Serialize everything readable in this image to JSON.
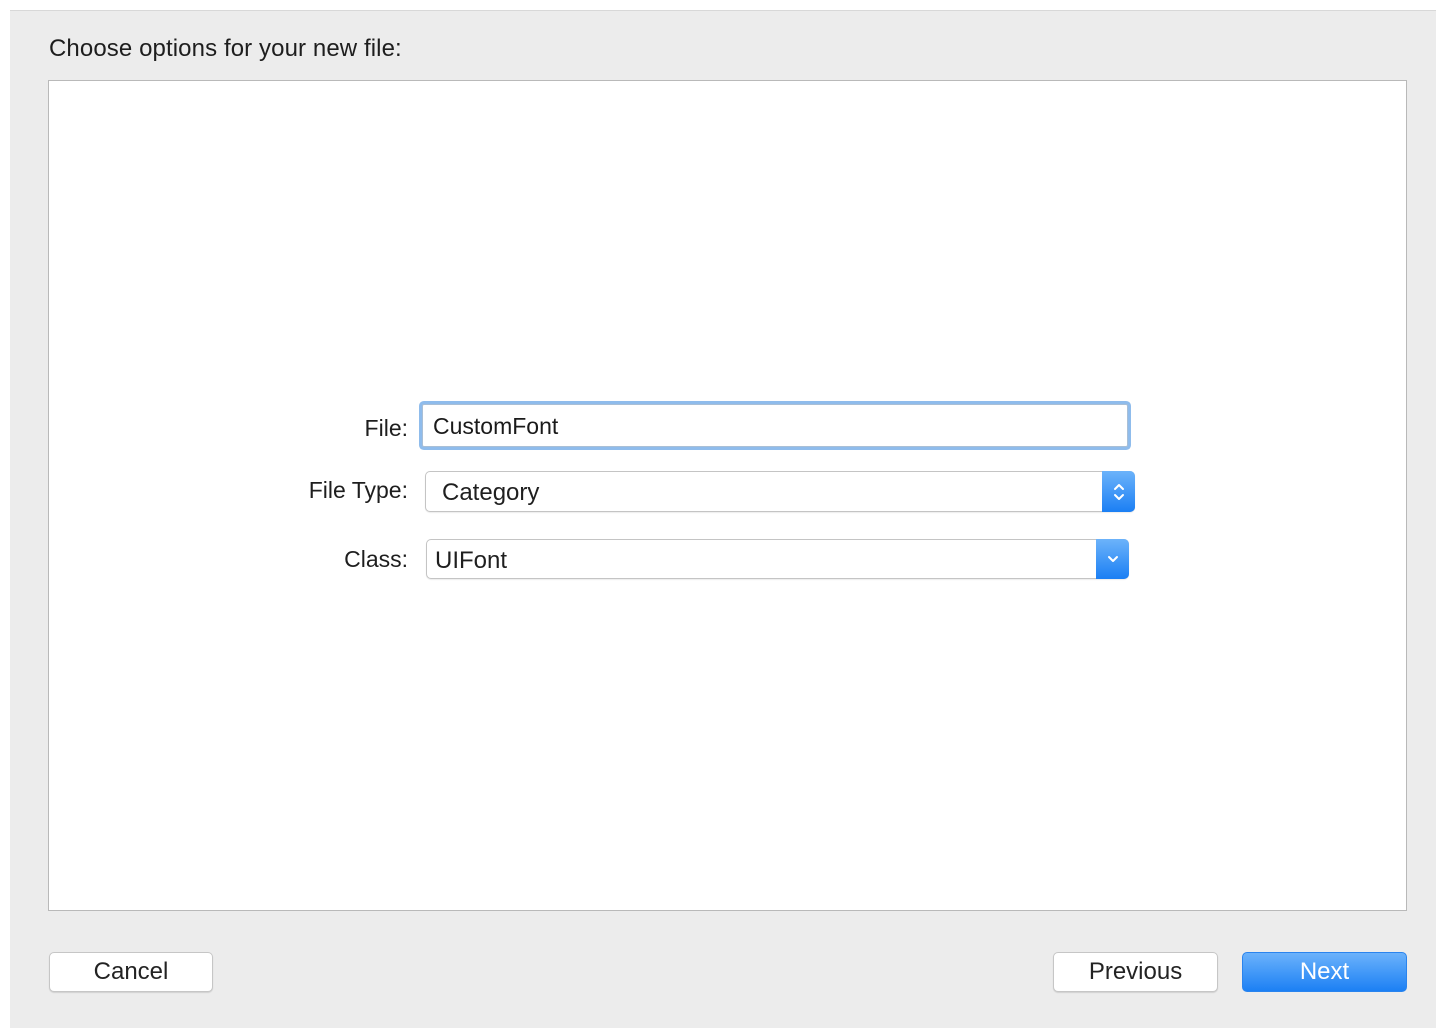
{
  "dialog": {
    "title": "Choose options for your new file:"
  },
  "form": {
    "file": {
      "label": "File:",
      "value": "CustomFont"
    },
    "file_type": {
      "label": "File Type:",
      "value": "Category",
      "icon": "stepper-arrows-icon"
    },
    "class": {
      "label": "Class:",
      "value": "UIFont",
      "icon": "chevron-down-icon"
    }
  },
  "buttons": {
    "cancel": "Cancel",
    "previous": "Previous",
    "next": "Next"
  },
  "colors": {
    "accent": "#1c80f4",
    "focus_ring": "#8fbcec",
    "sheet_background": "#ececec"
  }
}
